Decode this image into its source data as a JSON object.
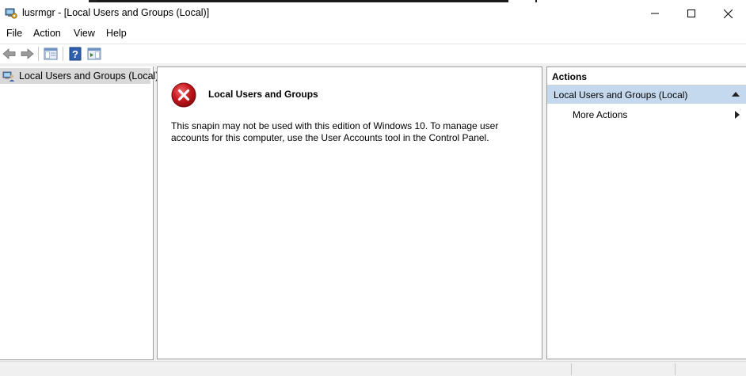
{
  "window": {
    "title": "lusrmgr - [Local Users and Groups (Local)]",
    "app_icon": "computer-management-icon",
    "controls": [
      "minimize-icon",
      "maximize-icon",
      "close-icon"
    ]
  },
  "menu": {
    "items": [
      "File",
      "Action",
      "View",
      "Help"
    ]
  },
  "toolbar": {
    "buttons": [
      "back-arrow-icon",
      "forward-arrow-icon",
      "show-hide-console-tree-icon",
      "help-icon",
      "show-hide-action-pane-icon"
    ]
  },
  "tree": {
    "items": [
      {
        "label": "Local Users and Groups (Local)",
        "icon": "users-groups-icon",
        "selected": true
      }
    ]
  },
  "result": {
    "heading": "Local Users and Groups",
    "message": "This snapin may not be used with this edition of Windows 10. To manage user accounts for this computer, use the User Accounts tool in the Control Panel.",
    "icon": "error-icon"
  },
  "actions": {
    "title": "Actions",
    "section": "Local Users and Groups (Local)",
    "items": [
      {
        "label": "More Actions",
        "icon": "chevron-right-icon"
      }
    ]
  },
  "colors": {
    "section_highlight": "#c5d9ee",
    "selected_tree_item": "#d9d9d9",
    "error_red": "#c4161c",
    "pane_border": "#9c9c9c"
  }
}
